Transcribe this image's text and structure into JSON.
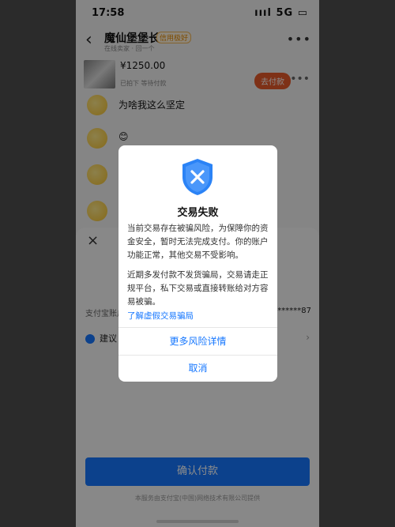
{
  "status_bar": {
    "time": "17:58",
    "icons": "ıııl 5G ▭"
  },
  "chat": {
    "back_icon": "chevron-left-icon",
    "title": "魔仙堡堡长",
    "tag": "信用极好",
    "subtitle": "在线卖家 · 回一个",
    "more": "•••"
  },
  "order": {
    "price": "¥1250.00",
    "subtitle": "已拍下 等待付款",
    "pay_button": "去付款",
    "more": "•••"
  },
  "messages": [
    {
      "text": "为啥我这么坚定"
    },
    {
      "text": "😊"
    },
    {
      "text": ""
    },
    {
      "text": ""
    }
  ],
  "sheet": {
    "close_icon": "×",
    "pay_method_label": "支付宝账户",
    "account_suffix": "*******87",
    "suggest_label": "建议",
    "confirm_button": "确认付款",
    "footer_note": "本服务由支付宝(中国)网络技术有限公司提供"
  },
  "dialog": {
    "icon": "shield-x-icon",
    "title": "交易失败",
    "body1": "当前交易存在被骗风险，为保障你的资金安全，暂时无法完成支付。你的账户功能正常，其他交易不受影响。",
    "body2": "近期多发付款不发货骗局，交易请走正规平台，私下交易或直接转账给对方容易被骗。",
    "link": "了解虚假交易骗局",
    "primary_button": "更多风险详情",
    "cancel_button": "取消"
  },
  "colors": {
    "accent": "#1677ff",
    "pay_orange": "#e55a2b",
    "tag_orange": "#e58a00"
  }
}
